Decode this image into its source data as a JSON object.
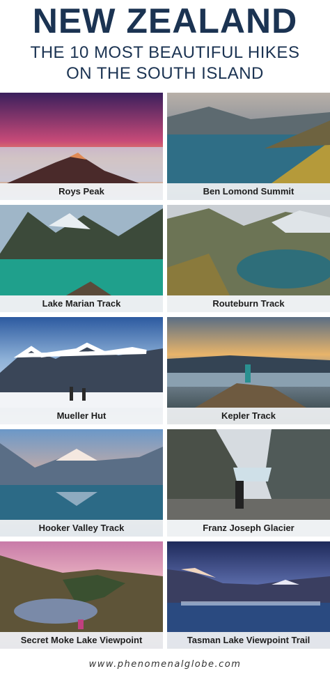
{
  "header": {
    "title": "NEW ZEALAND",
    "subtitle_line1": "THE 10 MOST BEAUTIFUL HIKES",
    "subtitle_line2": "ON THE SOUTH ISLAND"
  },
  "hikes": [
    {
      "name": "Roys Peak"
    },
    {
      "name": "Ben Lomond Summit"
    },
    {
      "name": "Lake Marian Track"
    },
    {
      "name": "Routeburn Track"
    },
    {
      "name": "Mueller Hut"
    },
    {
      "name": "Kepler Track"
    },
    {
      "name": "Hooker Valley Track"
    },
    {
      "name": "Franz Joseph Glacier"
    },
    {
      "name": "Secret Moke Lake Viewpoint"
    },
    {
      "name": "Tasman Lake Viewpoint Trail"
    }
  ],
  "footer": {
    "url": "www.phenomenalglobe.com"
  },
  "colors": {
    "title": "#1b3352"
  }
}
